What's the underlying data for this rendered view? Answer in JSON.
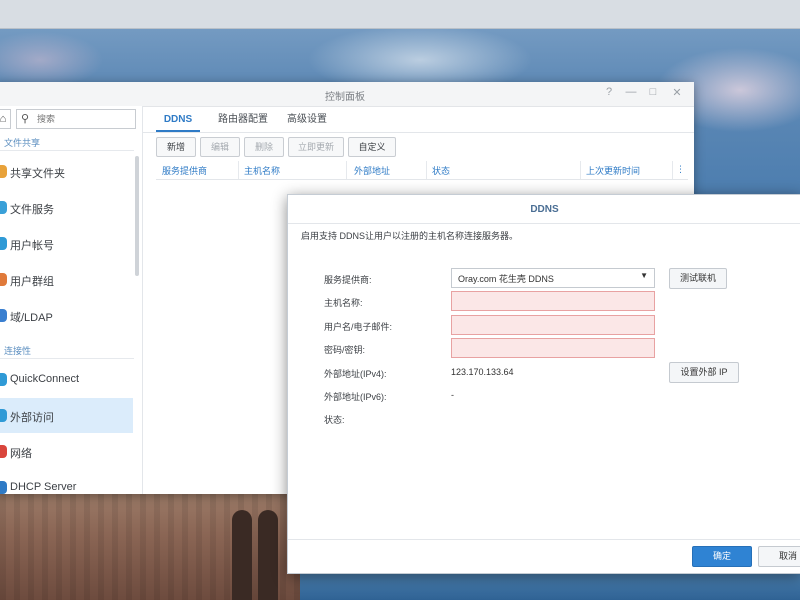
{
  "control_panel": {
    "title": "控制面板",
    "search_placeholder": "搜索",
    "sidebar": {
      "section_file_sharing": "文件共享",
      "section_connectivity": "连接性",
      "items": [
        {
          "label": "共享文件夹",
          "color": "#e8a23a"
        },
        {
          "label": "文件服务",
          "color": "#3aa0d8"
        },
        {
          "label": "用户帐号",
          "color": "#2f9ad6"
        },
        {
          "label": "用户群组",
          "color": "#e07a3a"
        },
        {
          "label": "域/LDAP",
          "color": "#3a7fd0"
        },
        {
          "label": "QuickConnect",
          "color": "#2f9ad6"
        },
        {
          "label": "外部访问",
          "color": "#2f9ad6"
        },
        {
          "label": "网络",
          "color": "#d9453c"
        },
        {
          "label": "DHCP Server",
          "color": "#2f7bc6"
        }
      ]
    },
    "tabs": [
      "DDNS",
      "路由器配置",
      "高级设置"
    ],
    "toolbar": {
      "add": "新增",
      "edit": "编辑",
      "delete": "删除",
      "update_now": "立即更新",
      "customize": "自定义"
    },
    "columns": [
      "服务提供商",
      "主机名称",
      "外部地址",
      "状态",
      "上次更新时间"
    ]
  },
  "dialog": {
    "title": "DDNS",
    "description": "启用支持 DDNS让用户以注册的主机名称连接服务器。",
    "labels": {
      "provider": "服务提供商:",
      "hostname": "主机名称:",
      "username": "用户名/电子邮件:",
      "password": "密码/密钥:",
      "ipv4": "外部地址(IPv4):",
      "ipv6": "外部地址(IPv6):",
      "status": "状态:"
    },
    "values": {
      "provider": "Oray.com 花生壳 DDNS",
      "hostname": "",
      "username": "",
      "password": "",
      "ipv4": "123.170.133.64",
      "ipv6": "-",
      "status": ""
    },
    "buttons": {
      "test": "测试联机",
      "set_external_ip": "设置外部 IP",
      "ok": "确定",
      "cancel": "取消"
    }
  }
}
